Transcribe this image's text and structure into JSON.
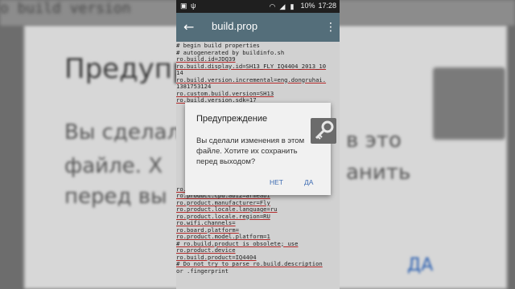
{
  "background": {
    "title": "Предупр",
    "lines": [
      "Вы сделал",
      "файле. Х",
      "перед вы"
    ],
    "right_lines": [
      "в это",
      "анить"
    ],
    "code_top": "o build version",
    "yes_text": "ДА"
  },
  "status_bar": {
    "battery": "10%",
    "time": "17:28"
  },
  "app": {
    "title": "build.prop"
  },
  "code_lines": [
    "# begin build properties",
    "# autogenerated by buildinfo.sh",
    "ro.build.id=JDQ39",
    "ro.build.display.id=SH13_FLY_IQ4404_2013_10",
    "14",
    "ro.build.version.incremental=eng.dongruhai.",
    "1381753124",
    "ro.custom.build.version=SH13",
    "ro.build.version.sdk=17",
    "",
    "",
    "",
    "",
    "",
    "",
    "",
    "",
    "",
    "",
    "",
    "",
    "ro.product.cpu.abi=armeabi-v7a",
    "ro.product.cpu.abi2=armeabi",
    "ro.product.manufacturer=Fly",
    "ro.product.locale.language=ru",
    "ro.product.locale.region=RU",
    "ro.wifi.channels=",
    "ro.board.platform=",
    "ro.product.model.platform=1",
    "# ro.build.product is obsolete; use",
    "ro.product.device",
    "ro.build.product=IQ4404",
    "# Do not try to parse ro.build.description",
    "or .fingerprint"
  ],
  "dialog": {
    "title": "Предупреждение",
    "message": "Вы сделали изменения в этом файле. Хотите их сохранить перед выходом?",
    "no_label": "НЕТ",
    "yes_label": "ДА"
  },
  "icons": [
    "back-arrow-icon",
    "overflow-menu-icon",
    "key-icon",
    "battery-icon",
    "wifi-icon",
    "signal-icon"
  ],
  "colors": {
    "appbar": "#546e7a",
    "dialog_button": "#3f6db3",
    "statusbar": "#1f1f1f"
  }
}
